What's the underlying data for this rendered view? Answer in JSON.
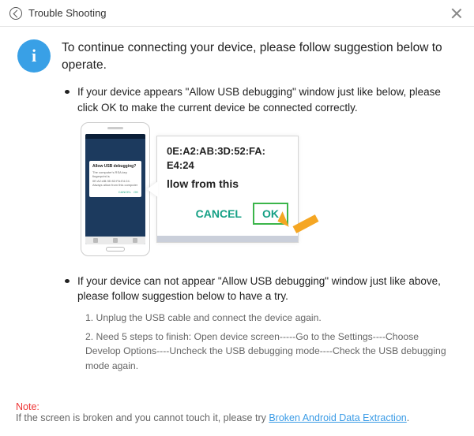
{
  "titlebar": {
    "title": "Trouble Shooting"
  },
  "intro": "To continue connecting your device, please follow suggestion below to operate.",
  "bullet1": "If your device appears \"Allow USB debugging\" window just like below, please click OK to make the current device  be connected correctly.",
  "mock": {
    "dialog_title": "Allow USB debugging?",
    "dialog_body": "The computer's RSA key fingerprint is 0E:A2:AB:3D:52:FA:E4:24. Always allow from this computer",
    "mac_line1": "0E:A2:AB:3D:52:FA:",
    "mac_line2": "E4:24",
    "mid_text": "llow from this",
    "cancel": "CANCEL",
    "ok": "OK"
  },
  "bullet2": "If your device can not appear \"Allow USB debugging\" window just like above, please follow suggestion below to have a try.",
  "steps": {
    "s1": "1. Unplug the USB cable and connect the device again.",
    "s2": "2. Need 5 steps to finish: Open device screen-----Go to the Settings----Choose Develop Options----Uncheck the USB debugging mode----Check the USB debugging mode again."
  },
  "footer": {
    "note": "Note:",
    "text": "If the screen is broken and you cannot touch it, please try ",
    "link": "Broken Android Data Extraction",
    "tail": "."
  }
}
